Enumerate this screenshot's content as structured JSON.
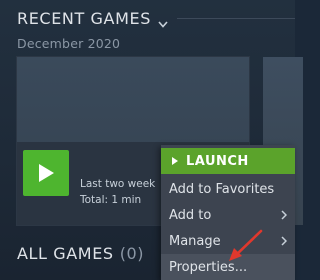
{
  "section": {
    "title": "RECENT GAMES",
    "date_label": "December 2020"
  },
  "game_tile": {
    "last_played": "Last two week",
    "total": "Total: 1 min"
  },
  "all_games": {
    "title": "ALL GAMES",
    "count": "(0)"
  },
  "context_menu": {
    "items": [
      {
        "label": "LAUNCH"
      },
      {
        "label": "Add to Favorites"
      },
      {
        "label": "Add to"
      },
      {
        "label": "Manage"
      },
      {
        "label": "Properties..."
      }
    ]
  },
  "colors": {
    "background": "#1b2838",
    "launch_green": "#5ba32b",
    "play_button": "#4eb52f",
    "menu_bg": "#3d4450",
    "annotation_arrow": "#e0382d"
  },
  "icons": {
    "launch": "play-triangle-icon",
    "submenu": "chevron-right-icon",
    "section_toggle": "chevron-down-icon",
    "annotation": "red-arrow-icon"
  }
}
